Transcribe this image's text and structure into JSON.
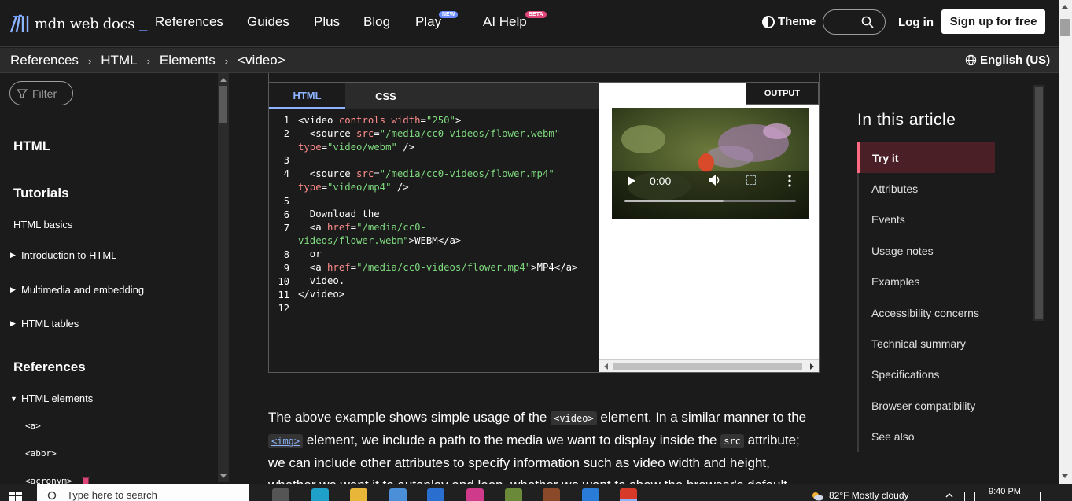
{
  "nav": {
    "logo_text": "mdn web docs",
    "logo_cursor": "_",
    "links": [
      "References",
      "Guides",
      "Plus",
      "Blog",
      "Play",
      "AI Help"
    ],
    "play_badge": "NEW",
    "ai_badge": "BETA",
    "theme_label": "Theme",
    "login_label": "Log in",
    "signup_label": "Sign up for free",
    "colors": {
      "accent": "#8cb4ff",
      "new_badge": "#6a8cff",
      "beta_badge": "#e0457a"
    }
  },
  "breadcrumb": {
    "items": [
      "References",
      "HTML",
      "Elements",
      "<video>"
    ],
    "separator": "›",
    "language": "English (US)"
  },
  "sidebar": {
    "filter_placeholder": "Filter",
    "heading_html": "HTML",
    "heading_tutorials": "Tutorials",
    "html_basics": "HTML basics",
    "intro": "Introduction to HTML",
    "multimedia": "Multimedia and embedding",
    "tables": "HTML tables",
    "heading_references": "References",
    "html_elements": "HTML elements",
    "el_a": "<a>",
    "el_abbr": "<abbr>",
    "el_acronym": "<acronym>"
  },
  "editor": {
    "tab_html": "HTML",
    "tab_css": "CSS",
    "output_label": "OUTPUT",
    "line_numbers": [
      "1",
      "2",
      "3",
      "4",
      "5",
      "6",
      "7",
      "8",
      "9",
      "10",
      "11",
      "12"
    ],
    "video_time": "0:00",
    "video_progress": 0.58
  },
  "article": {
    "p1_a": "The above example shows simple usage of the ",
    "code_video": "<video>",
    "p1_b": " element. In a similar manner to the ",
    "code_img": "<img>",
    "p1_c": " element, we include a path to the media we want to display inside the ",
    "code_src": "src",
    "p1_d": " attribute; we can include other attributes to specify information such as video width and height, whether we want it to autoplay and loop, whether we want to show the browser's default"
  },
  "toc": {
    "title": "In this article",
    "items": [
      "Try it",
      "Attributes",
      "Events",
      "Usage notes",
      "Examples",
      "Accessibility concerns",
      "Technical summary",
      "Specifications",
      "Browser compatibility",
      "See also"
    ]
  },
  "taskbar": {
    "search_placeholder": "Type here to search",
    "weather": "82°F  Mostly cloudy",
    "time": "9:40 PM"
  }
}
